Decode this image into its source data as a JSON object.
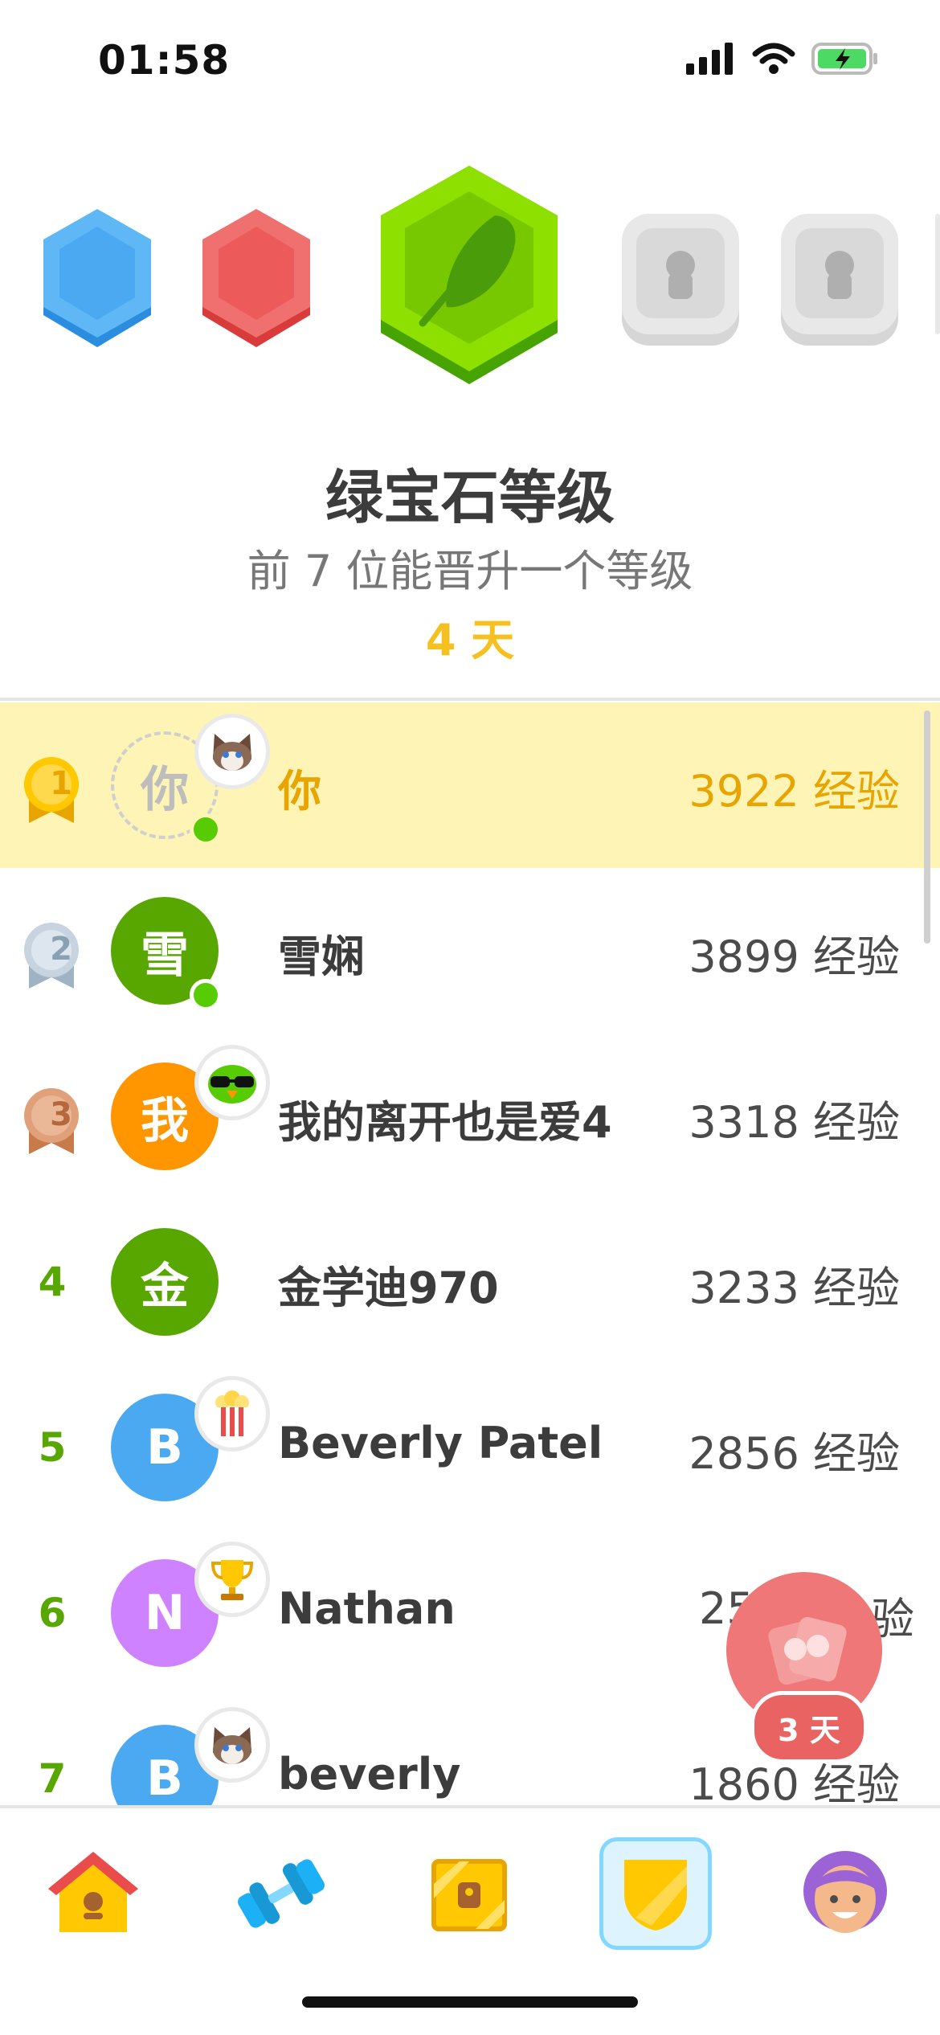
{
  "status_bar": {
    "time": "01:58"
  },
  "league": {
    "title": "绿宝石等级",
    "subtitle": "前 7 位能晋升一个等级",
    "days_left": "4 天"
  },
  "leaderboard": [
    {
      "rank": "1",
      "avatar_text": "你",
      "avatar_color": "#ffffff",
      "name": "你",
      "xp": "3922 经验",
      "medal": "gold",
      "online": true,
      "sticker": "cat-sticker-icon",
      "highlight": true
    },
    {
      "rank": "2",
      "avatar_text": "雪",
      "avatar_color": "#58a700",
      "name": "雪娴",
      "xp": "3899 经验",
      "medal": "silver",
      "online": true,
      "sticker": ""
    },
    {
      "rank": "3",
      "avatar_text": "我",
      "avatar_color": "#ff9600",
      "name": "我的离开也是爱4",
      "xp": "3318 经验",
      "medal": "bronze",
      "online": false,
      "sticker": "cool-owl-sticker-icon"
    },
    {
      "rank": "4",
      "avatar_text": "金",
      "avatar_color": "#58a700",
      "name": "金学迪970",
      "xp": "3233 经验",
      "medal": "",
      "online": false,
      "sticker": ""
    },
    {
      "rank": "5",
      "avatar_text": "B",
      "avatar_color": "#4aa9f0",
      "name": "Beverly Patel",
      "xp": "2856 经验",
      "medal": "",
      "online": false,
      "sticker": "popcorn-sticker-icon"
    },
    {
      "rank": "6",
      "avatar_text": "N",
      "avatar_color": "#ce82ff",
      "name": "Nathan",
      "xp": "25",
      "xp_tail": "验",
      "medal": "",
      "online": false,
      "sticker": "trophy-sticker-icon"
    },
    {
      "rank": "7",
      "avatar_text": "B",
      "avatar_color": "#4aa9f0",
      "name": "beverly",
      "xp": "1860 经验",
      "medal": "",
      "online": false,
      "sticker": "cat-sticker-icon"
    }
  ],
  "chest_timer": "3 天",
  "nav": [
    "home-icon",
    "practice-dumbbell-icon",
    "treasure-chest-icon",
    "leaderboard-shield-icon",
    "profile-avatar-icon"
  ]
}
